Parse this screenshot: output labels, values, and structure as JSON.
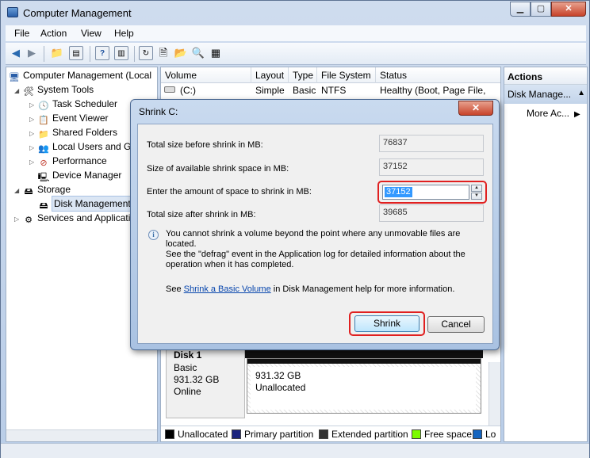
{
  "window": {
    "title": "Computer Management",
    "min": "▁",
    "max": "▢",
    "close": "✕"
  },
  "menu": [
    "File",
    "Action",
    "View",
    "Help"
  ],
  "tree": {
    "root": "Computer Management (Local",
    "system_tools": "System Tools",
    "task_scheduler": "Task Scheduler",
    "event_viewer": "Event Viewer",
    "shared_folders": "Shared Folders",
    "local_users": "Local Users and Groups",
    "performance": "Performance",
    "device_manager": "Device Manager",
    "storage": "Storage",
    "disk_management": "Disk Management",
    "services": "Services and Applications"
  },
  "volume_list": {
    "headers": [
      "Volume",
      "Layout",
      "Type",
      "File System",
      "Status"
    ],
    "rows": [
      {
        "volume": "(C:)",
        "layout": "Simple",
        "type": "Basic",
        "fs": "NTFS",
        "status": "Healthy (Boot, Page File, Cra"
      }
    ]
  },
  "disk": {
    "name": "Disk 1",
    "type": "Basic",
    "size": "931.32 GB",
    "state": "Online",
    "partition_size": "931.32 GB",
    "partition_status": "Unallocated"
  },
  "legend": [
    "Unallocated",
    "Primary partition",
    "Extended partition",
    "Free space",
    "Lo"
  ],
  "legend_colors": [
    "#000000",
    "#1a237e",
    "#333333",
    "#7cfc00",
    "#1565c0"
  ],
  "actions": {
    "header": "Actions",
    "section": "Disk Manage...",
    "more": "More Ac..."
  },
  "dialog": {
    "title": "Shrink C:",
    "total_before_label": "Total size before shrink in MB:",
    "total_before_value": "76837",
    "available_label": "Size of available shrink space in MB:",
    "available_value": "37152",
    "amount_label": "Enter the amount of space to shrink in MB:",
    "amount_value": "37152",
    "after_label": "Total size after shrink in MB:",
    "after_value": "39685",
    "info_line1": "You cannot shrink a volume beyond the point where any unmovable files are located.",
    "info_line2": "See the \"defrag\" event in the Application log for detailed information about the",
    "info_line3": "operation when it has completed.",
    "see_prefix": "See ",
    "see_link": "Shrink a Basic Volume",
    "see_suffix": " in Disk Management help for more information.",
    "shrink_button": "Shrink",
    "cancel_button": "Cancel"
  }
}
